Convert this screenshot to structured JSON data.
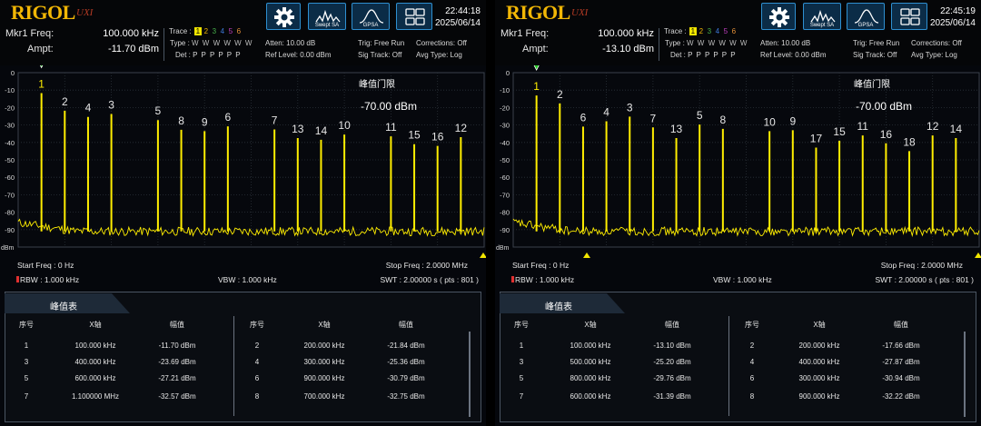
{
  "colors": {
    "trace": "#ffee00",
    "brand": "#f2b705",
    "marker": "#22cc22",
    "accent": "#2e8fd0"
  },
  "panels": [
    {
      "logo": "RIGOL",
      "logo_sub": "UXI",
      "buttons": {
        "settings_icon": "gear-icon",
        "swept": "Swept SA",
        "gpsa": "GPSA",
        "layout_icon": "grid-icon"
      },
      "time": "22:44:18",
      "date": "2025/06/14",
      "marker": {
        "freq_label": "Mkr1 Freq:",
        "freq": "100.000 kHz",
        "ampt_label": "Ampt:",
        "ampt": "-11.70 dBm"
      },
      "trace": {
        "label": "Trace :",
        "nums": [
          "1",
          "2",
          "3",
          "4",
          "5",
          "6"
        ],
        "type_label": "Type :",
        "types": "W W W W W W",
        "det_label": "Det :",
        "dets": "P P P P P P"
      },
      "settings": {
        "atten": "Atten: 10.00 dB",
        "ref": "Ref Level: 0.00 dBm",
        "trig": "Trig: Free Run",
        "sig": "Sig Track: Off",
        "corr": "Corrections: Off",
        "avg": "Avg Type: Log"
      },
      "plot": {
        "yticks": [
          "0",
          "-10",
          "-20",
          "-30",
          "-40",
          "-50",
          "-60",
          "-70",
          "-80",
          "-90"
        ],
        "unit": "dBm",
        "threshold_title": "峰值门限",
        "threshold_value": "-70.00 dBm"
      },
      "chart_data": {
        "type": "line",
        "xlim": [
          0,
          2.0
        ],
        "ylim": [
          -100,
          0
        ],
        "xunit": "MHz",
        "yunit": "dBm",
        "peaks": [
          {
            "label": "1",
            "x": 0.1,
            "y": -11.7
          },
          {
            "label": "2",
            "x": 0.2,
            "y": -21.84
          },
          {
            "label": "4",
            "x": 0.3,
            "y": -25.36
          },
          {
            "label": "3",
            "x": 0.4,
            "y": -23.69
          },
          {
            "label": "5",
            "x": 0.6,
            "y": -27.21
          },
          {
            "label": "8",
            "x": 0.7,
            "y": -32.75
          },
          {
            "label": "9",
            "x": 0.8,
            "y": -33.5
          },
          {
            "label": "6",
            "x": 0.9,
            "y": -30.79
          },
          {
            "label": "7",
            "x": 1.1,
            "y": -32.57
          },
          {
            "label": "13",
            "x": 1.2,
            "y": -37.5
          },
          {
            "label": "14",
            "x": 1.3,
            "y": -38.5
          },
          {
            "label": "10",
            "x": 1.4,
            "y": -35.5
          },
          {
            "label": "11",
            "x": 1.6,
            "y": -36.5
          },
          {
            "label": "15",
            "x": 1.7,
            "y": -41
          },
          {
            "label": "16",
            "x": 1.8,
            "y": -42
          },
          {
            "label": "12",
            "x": 1.9,
            "y": -37
          }
        ],
        "noise_floor": -91
      },
      "footer": {
        "start": "Start Freq : 0 Hz",
        "stop": "Stop Freq : 2.0000 MHz",
        "rbw": "RBW : 1.000 kHz",
        "vbw": "VBW : 1.000 kHz",
        "swt": "SWT : 2.00000 s ( pts : 801 )"
      },
      "table": {
        "title": "峰值表",
        "headers": [
          "序号",
          "X轴",
          "幅值",
          "序号",
          "X轴",
          "幅值"
        ],
        "rows": [
          [
            "1",
            "100.000 kHz",
            "-11.70 dBm",
            "2",
            "200.000 kHz",
            "-21.84 dBm"
          ],
          [
            "3",
            "400.000 kHz",
            "-23.69 dBm",
            "4",
            "300.000 kHz",
            "-25.36 dBm"
          ],
          [
            "5",
            "600.000 kHz",
            "-27.21 dBm",
            "6",
            "900.000 kHz",
            "-30.79 dBm"
          ],
          [
            "7",
            "1.100000 MHz",
            "-32.57 dBm",
            "8",
            "700.000 kHz",
            "-32.75 dBm"
          ]
        ]
      }
    },
    {
      "logo": "RIGOL",
      "logo_sub": "UXI",
      "buttons": {
        "settings_icon": "gear-icon",
        "swept": "Swept SA",
        "gpsa": "GPSA",
        "layout_icon": "grid-icon"
      },
      "time": "22:45:19",
      "date": "2025/06/14",
      "marker": {
        "freq_label": "Mkr1 Freq:",
        "freq": "100.000 kHz",
        "ampt_label": "Ampt:",
        "ampt": "-13.10 dBm"
      },
      "trace": {
        "label": "Trace :",
        "nums": [
          "1",
          "2",
          "3",
          "4",
          "5",
          "6"
        ],
        "type_label": "Type :",
        "types": "W W W W W W",
        "det_label": "Det :",
        "dets": "P P P P P P"
      },
      "settings": {
        "atten": "Atten: 10.00 dB",
        "ref": "Ref Level: 0.00 dBm",
        "trig": "Trig: Free Run",
        "sig": "Sig Track: Off",
        "corr": "Corrections: Off",
        "avg": "Avg Type: Log"
      },
      "plot": {
        "yticks": [
          "0",
          "-10",
          "-20",
          "-30",
          "-40",
          "-50",
          "-60",
          "-70",
          "-80",
          "-90"
        ],
        "unit": "dBm",
        "threshold_title": "峰值门限",
        "threshold_value": "-70.00 dBm"
      },
      "chart_data": {
        "type": "line",
        "xlim": [
          0,
          2.0
        ],
        "ylim": [
          -100,
          0
        ],
        "xunit": "MHz",
        "yunit": "dBm",
        "peaks": [
          {
            "label": "1",
            "x": 0.1,
            "y": -13.1
          },
          {
            "label": "2",
            "x": 0.2,
            "y": -17.66
          },
          {
            "label": "6",
            "x": 0.3,
            "y": -30.94
          },
          {
            "label": "4",
            "x": 0.4,
            "y": -27.87
          },
          {
            "label": "3",
            "x": 0.5,
            "y": -25.2
          },
          {
            "label": "7",
            "x": 0.6,
            "y": -31.39
          },
          {
            "label": "13",
            "x": 0.7,
            "y": -37.5
          },
          {
            "label": "5",
            "x": 0.8,
            "y": -29.76
          },
          {
            "label": "8",
            "x": 0.9,
            "y": -32.22
          },
          {
            "label": "10",
            "x": 1.1,
            "y": -33.5
          },
          {
            "label": "9",
            "x": 1.2,
            "y": -33
          },
          {
            "label": "17",
            "x": 1.3,
            "y": -43
          },
          {
            "label": "15",
            "x": 1.4,
            "y": -39
          },
          {
            "label": "11",
            "x": 1.5,
            "y": -36
          },
          {
            "label": "16",
            "x": 1.6,
            "y": -40.5
          },
          {
            "label": "18",
            "x": 1.7,
            "y": -45
          },
          {
            "label": "12",
            "x": 1.8,
            "y": -36
          },
          {
            "label": "14",
            "x": 1.9,
            "y": -37.5
          }
        ],
        "noise_floor": -91
      },
      "footer": {
        "start": "Start Freq : 0 Hz",
        "stop": "Stop Freq : 2.0000 MHz",
        "rbw": "RBW : 1.000 kHz",
        "vbw": "VBW : 1.000 kHz",
        "swt": "SWT : 2.00000 s ( pts : 801 )"
      },
      "table": {
        "title": "峰值表",
        "headers": [
          "序号",
          "X轴",
          "幅值",
          "序号",
          "X轴",
          "幅值"
        ],
        "rows": [
          [
            "1",
            "100.000 kHz",
            "-13.10 dBm",
            "2",
            "200.000 kHz",
            "-17.66 dBm"
          ],
          [
            "3",
            "500.000 kHz",
            "-25.20 dBm",
            "4",
            "400.000 kHz",
            "-27.87 dBm"
          ],
          [
            "5",
            "800.000 kHz",
            "-29.76 dBm",
            "6",
            "300.000 kHz",
            "-30.94 dBm"
          ],
          [
            "7",
            "600.000 kHz",
            "-31.39 dBm",
            "8",
            "900.000 kHz",
            "-32.22 dBm"
          ]
        ]
      }
    }
  ]
}
